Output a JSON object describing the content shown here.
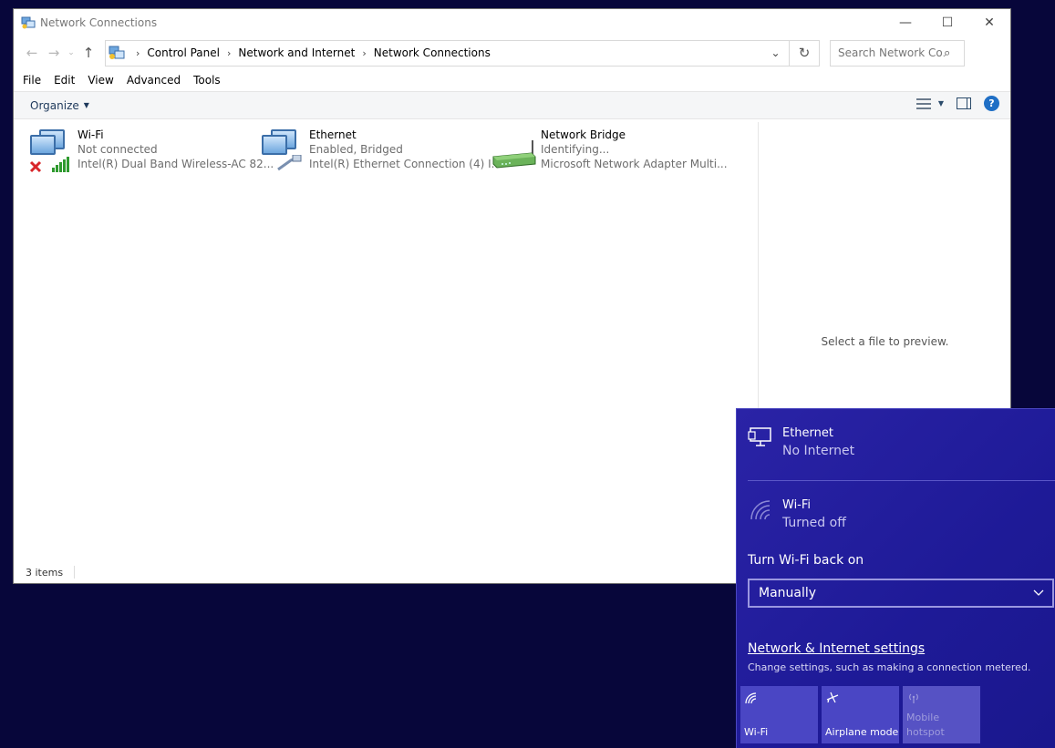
{
  "window": {
    "title": "Network Connections",
    "minimize": "—",
    "maximize": "☐",
    "close": "✕"
  },
  "navigation": {
    "back": "←",
    "forward": "→",
    "recent": "⌄",
    "up": "↑",
    "breadcrumbs": [
      "Control Panel",
      "Network and Internet",
      "Network Connections"
    ],
    "address_dropdown": "⌄",
    "refresh": "↻",
    "search_placeholder": "Search Network Co...",
    "search_icon": "⌕"
  },
  "menu": [
    "File",
    "Edit",
    "View",
    "Advanced",
    "Tools"
  ],
  "command_bar": {
    "organize": "Organize",
    "caret": "▼",
    "view_caret": "▼",
    "help": "?"
  },
  "items": [
    {
      "name": "Wi-Fi",
      "status": "Not connected",
      "device": "Intel(R) Dual Band Wireless-AC 82...",
      "icon": "wifi-adapter-disconnected-icon"
    },
    {
      "name": "Ethernet",
      "status": "Enabled, Bridged",
      "device": "Intel(R) Ethernet Connection (4) I...",
      "icon": "ethernet-adapter-icon"
    },
    {
      "name": "Network Bridge",
      "status": "Identifying...",
      "device": "Microsoft Network Adapter Multi...",
      "icon": "network-bridge-icon"
    }
  ],
  "preview_text": "Select a file to preview.",
  "status_bar": {
    "count": "3 items"
  },
  "flyout": {
    "ethernet": {
      "name": "Ethernet",
      "status": "No Internet"
    },
    "wifi": {
      "name": "Wi-Fi",
      "status": "Turned off"
    },
    "turn_on_label": "Turn Wi-Fi back on",
    "turn_on_value": "Manually",
    "settings_link": "Network & Internet settings",
    "settings_hint": "Change settings, such as making a connection metered.",
    "tiles": [
      {
        "label": "Wi-Fi",
        "enabled": true
      },
      {
        "label": "Airplane mode",
        "enabled": true
      },
      {
        "label": "Mobile hotspot",
        "enabled": false
      }
    ]
  },
  "colors": {
    "desktop": "#07063a",
    "flyout": "#2a23a6",
    "help": "#1f6fc5"
  }
}
